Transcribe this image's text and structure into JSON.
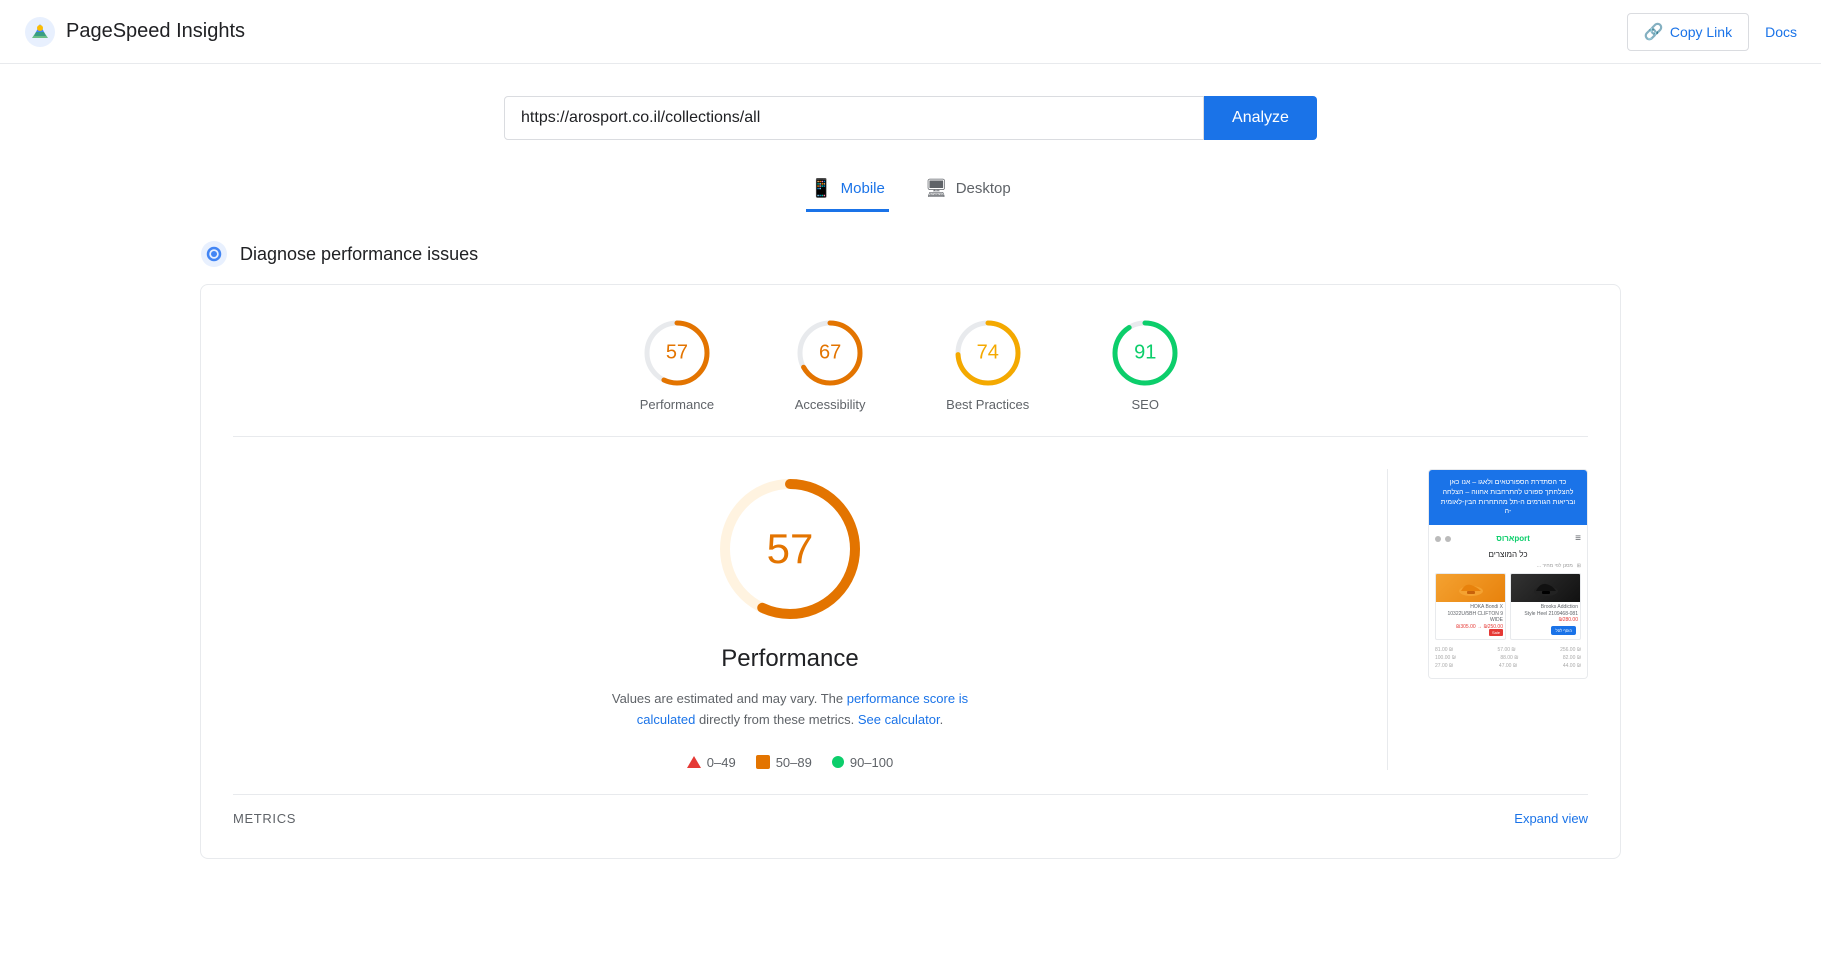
{
  "header": {
    "app_title": "PageSpeed Insights",
    "copy_link_label": "Copy Link",
    "docs_label": "Docs"
  },
  "search": {
    "url_value": "https://arosport.co.il/collections/all",
    "analyze_label": "Analyze"
  },
  "tabs": [
    {
      "id": "mobile",
      "label": "Mobile",
      "active": true
    },
    {
      "id": "desktop",
      "label": "Desktop",
      "active": false
    }
  ],
  "diagnose": {
    "heading": "Diagnose performance issues"
  },
  "scores": [
    {
      "id": "performance",
      "value": 57,
      "label": "Performance",
      "color": "#e37400",
      "pct": 57
    },
    {
      "id": "accessibility",
      "value": 67,
      "label": "Accessibility",
      "color": "#e37400",
      "pct": 67
    },
    {
      "id": "best-practices",
      "value": 74,
      "label": "Best Practices",
      "color": "#f4a900",
      "pct": 74
    },
    {
      "id": "seo",
      "value": 91,
      "label": "SEO",
      "color": "#0cce6b",
      "pct": 91
    }
  ],
  "detail": {
    "score": 57,
    "title": "Performance",
    "description_start": "Values are estimated and may vary. The ",
    "description_link1": "performance score is calculated",
    "description_mid": " directly from these metrics. ",
    "description_link2": "See calculator",
    "description_end": ".",
    "legend": [
      {
        "type": "red",
        "range": "0–49"
      },
      {
        "type": "orange",
        "range": "50–89"
      },
      {
        "type": "green",
        "range": "90–100"
      }
    ]
  },
  "metrics": {
    "label": "METRICS",
    "expand_label": "Expand view"
  },
  "screenshot": {
    "banner_text": "כד הסתדרת הספורטאים ולאגו – אנו כאן להצלחתך\nספורט להתרחבות אחווה – הצלחה ובריאות הגורמים ה-תל\nמהתחרות הבין-לאומית ה-"
  }
}
